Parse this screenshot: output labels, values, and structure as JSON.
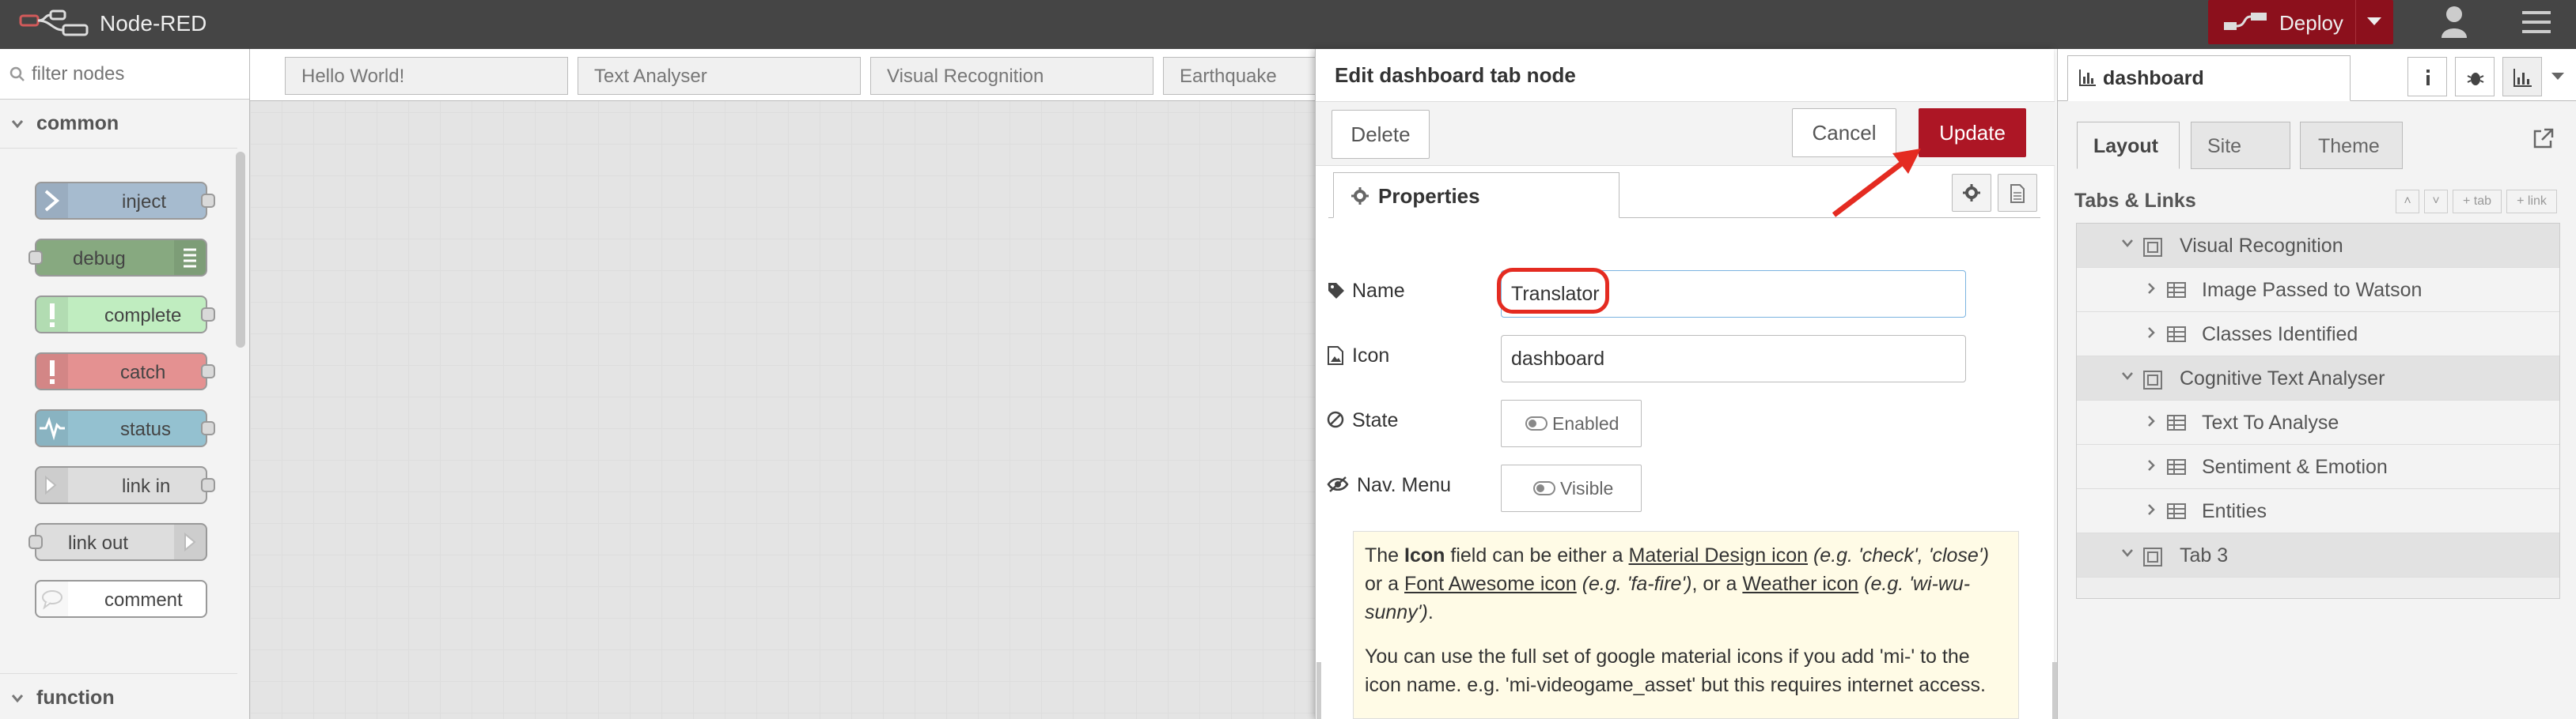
{
  "app": {
    "title": "Node-RED"
  },
  "header": {
    "deploy_label": "Deploy"
  },
  "palette": {
    "filter_placeholder": "filter nodes",
    "categories": [
      {
        "label": "common"
      },
      {
        "label": "function"
      }
    ],
    "nodes": [
      {
        "label": "inject",
        "color": "#a6bbcf"
      },
      {
        "label": "debug",
        "color": "#87a980"
      },
      {
        "label": "complete",
        "color": "#c0edc0"
      },
      {
        "label": "catch",
        "color": "#e49191"
      },
      {
        "label": "status",
        "color": "#94c1d0"
      },
      {
        "label": "link in",
        "color": "#dddddd"
      },
      {
        "label": "link out",
        "color": "#dddddd"
      },
      {
        "label": "comment",
        "color": "#ffffff"
      }
    ]
  },
  "workspace": {
    "tabs": [
      "Hello World!",
      "Text Analyser",
      "Visual Recognition",
      "Earthquake"
    ]
  },
  "tray": {
    "title": "Edit dashboard tab node",
    "delete_label": "Delete",
    "cancel_label": "Cancel",
    "update_label": "Update",
    "tab_label": "Properties",
    "fields": {
      "name_label": "Name",
      "name_value": "Translator",
      "icon_label": "Icon",
      "icon_value": "dashboard",
      "state_label": "State",
      "state_value": "Enabled",
      "nav_label": "Nav. Menu",
      "nav_value": "Visible"
    },
    "help": {
      "p1_a": "The ",
      "p1_b": "Icon",
      "p1_c": " field can be either a ",
      "p1_link1": "Material Design icon",
      "p1_ex1": " (e.g. 'check', 'close')",
      "p1_d": " or a ",
      "p1_link2": "Font Awesome icon",
      "p1_ex2": " (e.g. 'fa-fire')",
      "p1_e": ", or a ",
      "p1_link3": "Weather icon",
      "p1_ex3": " (e.g. 'wi-wu-sunny')",
      "p1_f": ".",
      "p2": "You can use the full set of google material icons if you add 'mi-' to the icon name. e.g. 'mi-videogame_asset' but this requires internet access."
    }
  },
  "sidebar": {
    "active_tab": "dashboard",
    "dash_tabs": [
      "Layout",
      "Site",
      "Theme"
    ],
    "section_title": "Tabs & Links",
    "mini_buttons": [
      "tab",
      "link"
    ],
    "tree": [
      {
        "kind": "tab",
        "label": "Visual Recognition"
      },
      {
        "kind": "group",
        "label": "Image Passed to Watson"
      },
      {
        "kind": "group",
        "label": "Classes Identified"
      },
      {
        "kind": "tab",
        "label": "Cognitive Text Analyser"
      },
      {
        "kind": "group",
        "label": "Text To Analyse"
      },
      {
        "kind": "group",
        "label": "Sentiment & Emotion"
      },
      {
        "kind": "group",
        "label": "Entities"
      },
      {
        "kind": "tab",
        "label": "Tab 3"
      }
    ]
  },
  "colors": {
    "header": "#454545",
    "deploy": "#8c101c",
    "update": "#ad1625",
    "highlight": "#e42b21"
  }
}
